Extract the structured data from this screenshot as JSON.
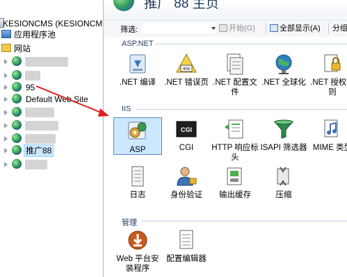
{
  "tree": {
    "server_label": "KESIONCMS (KESIONCMS\\",
    "app_pools_label": "应用程序池",
    "sites_label": "网站",
    "site_95_label": "95",
    "default_site_label": "Default Web Site",
    "tuiguang_label": "推广88"
  },
  "header": {
    "title": "推广 88 主页"
  },
  "toolbar": {
    "filter_label": "筛选:",
    "filter_value": "",
    "go_label": "开始(G)",
    "show_all_label": "全部显示(A)",
    "group_label": "分组"
  },
  "groups": {
    "aspnet": {
      "title": "ASP.NET",
      "items": [
        {
          "label": ".NET 编译",
          "icon": "dotnet-compile-icon"
        },
        {
          "label": ".NET 错误页",
          "icon": "dotnet-error-page-icon"
        },
        {
          "label": ".NET 配置文件",
          "icon": "dotnet-profile-icon"
        },
        {
          "label": ".NET 全球化",
          "icon": "dotnet-globalization-icon"
        },
        {
          "label": ".NET 授权规则",
          "icon": "dotnet-authorization-icon"
        }
      ]
    },
    "iis": {
      "title": "IIS",
      "items": [
        {
          "label": "ASP",
          "icon": "asp-icon"
        },
        {
          "label": "CGI",
          "icon": "cgi-icon"
        },
        {
          "label": "HTTP 响应标头",
          "icon": "http-headers-icon"
        },
        {
          "label": "ISAPI 筛选器",
          "icon": "isapi-filter-icon"
        },
        {
          "label": "MIME 类型",
          "icon": "mime-types-icon"
        },
        {
          "label": "日志",
          "icon": "logging-icon"
        },
        {
          "label": "身份验证",
          "icon": "authentication-icon"
        },
        {
          "label": "输出缓存",
          "icon": "output-cache-icon"
        },
        {
          "label": "压缩",
          "icon": "compression-icon"
        }
      ]
    },
    "management": {
      "title": "管理",
      "items": [
        {
          "label": "Web 平台安装程序",
          "icon": "web-platform-installer-icon"
        },
        {
          "label": "配置编辑器",
          "icon": "configuration-editor-icon"
        }
      ]
    }
  },
  "colors": {
    "accent": "#1e395b",
    "selection": "#cce8ff",
    "annotation_arrow": "#e02020"
  }
}
